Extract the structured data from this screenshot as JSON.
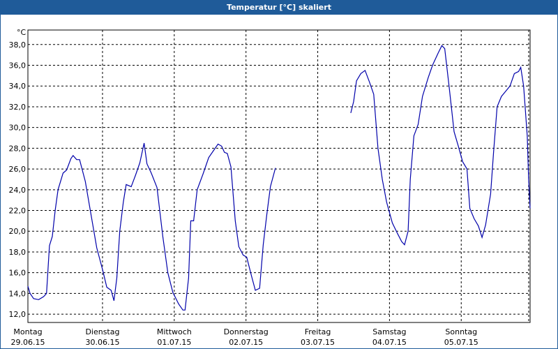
{
  "window": {
    "title": "Temperatur [°C] skaliert"
  },
  "chart_data": {
    "type": "line",
    "title": "Temperatur [°C] skaliert",
    "ylabel": "°C",
    "xlabel": "",
    "ylim": [
      11.2,
      39.4
    ],
    "xlim": [
      0,
      7
    ],
    "grid": true,
    "yticks": [
      "12,0",
      "14,0",
      "16,0",
      "18,0",
      "20,0",
      "22,0",
      "24,0",
      "26,0",
      "28,0",
      "30,0",
      "32,0",
      "34,0",
      "36,0",
      "38,0"
    ],
    "ytick_values": [
      12,
      14,
      16,
      18,
      20,
      22,
      24,
      26,
      28,
      30,
      32,
      34,
      36,
      38
    ],
    "xtick_labels": [
      {
        "day": "Montag",
        "date": "29.06.15"
      },
      {
        "day": "Dienstag",
        "date": "30.06.15"
      },
      {
        "day": "Mittwoch",
        "date": "01.07.15"
      },
      {
        "day": "Donnerstag",
        "date": "02.07.15"
      },
      {
        "day": "Freitag",
        "date": "03.07.15"
      },
      {
        "day": "Samstag",
        "date": "04.07.15"
      },
      {
        "day": "Sonntag",
        "date": "05.07.15"
      }
    ],
    "series": [
      {
        "color": "#0000aa",
        "segments": [
          [
            [
              0.0,
              14.7
            ],
            [
              0.03,
              14.0
            ],
            [
              0.08,
              13.5
            ],
            [
              0.15,
              13.4
            ],
            [
              0.22,
              13.7
            ],
            [
              0.26,
              14.0
            ],
            [
              0.3,
              18.6
            ],
            [
              0.34,
              19.5
            ],
            [
              0.38,
              22.0
            ],
            [
              0.42,
              24.0
            ],
            [
              0.49,
              25.6
            ],
            [
              0.54,
              25.9
            ],
            [
              0.6,
              27.0
            ],
            [
              0.63,
              27.3
            ],
            [
              0.68,
              26.9
            ],
            [
              0.72,
              26.9
            ],
            [
              0.8,
              24.8
            ],
            [
              0.88,
              21.6
            ],
            [
              0.96,
              18.4
            ],
            [
              1.04,
              16.3
            ],
            [
              1.1,
              14.6
            ],
            [
              1.16,
              14.3
            ],
            [
              1.2,
              13.3
            ],
            [
              1.24,
              15.5
            ],
            [
              1.28,
              20.0
            ],
            [
              1.33,
              22.8
            ],
            [
              1.37,
              24.5
            ],
            [
              1.44,
              24.3
            ],
            [
              1.5,
              25.4
            ],
            [
              1.56,
              26.6
            ],
            [
              1.62,
              28.5
            ],
            [
              1.66,
              26.5
            ],
            [
              1.72,
              25.6
            ],
            [
              1.8,
              24.2
            ],
            [
              1.88,
              19.5
            ],
            [
              1.95,
              16.0
            ],
            [
              2.02,
              14.1
            ],
            [
              2.1,
              13.0
            ],
            [
              2.16,
              12.4
            ],
            [
              2.19,
              12.4
            ],
            [
              2.24,
              15.5
            ],
            [
              2.27,
              21.0
            ],
            [
              2.31,
              21.0
            ],
            [
              2.36,
              24.0
            ],
            [
              2.44,
              25.5
            ],
            [
              2.52,
              27.1
            ],
            [
              2.6,
              27.9
            ],
            [
              2.65,
              28.4
            ],
            [
              2.7,
              28.2
            ],
            [
              2.74,
              27.6
            ],
            [
              2.78,
              27.5
            ],
            [
              2.83,
              26.2
            ],
            [
              2.89,
              21.0
            ],
            [
              2.94,
              18.5
            ],
            [
              3.0,
              17.7
            ],
            [
              3.05,
              17.5
            ],
            [
              3.12,
              15.6
            ],
            [
              3.17,
              14.3
            ],
            [
              3.23,
              14.5
            ],
            [
              3.28,
              18.7
            ],
            [
              3.33,
              21.6
            ],
            [
              3.38,
              24.3
            ],
            [
              3.45,
              26.1
            ]
          ],
          [
            [
              4.5,
              31.4
            ],
            [
              4.54,
              32.5
            ],
            [
              4.58,
              34.5
            ],
            [
              4.64,
              35.2
            ],
            [
              4.7,
              35.5
            ],
            [
              4.76,
              34.4
            ],
            [
              4.82,
              33.2
            ],
            [
              4.88,
              28.0
            ],
            [
              4.94,
              25.0
            ],
            [
              5.0,
              22.8
            ],
            [
              5.08,
              20.8
            ],
            [
              5.15,
              19.8
            ],
            [
              5.21,
              19.0
            ],
            [
              5.25,
              18.7
            ],
            [
              5.3,
              20.0
            ],
            [
              5.33,
              25.0
            ],
            [
              5.38,
              29.2
            ],
            [
              5.44,
              30.3
            ],
            [
              5.5,
              33.0
            ],
            [
              5.58,
              34.8
            ],
            [
              5.64,
              36.0
            ],
            [
              5.72,
              37.2
            ],
            [
              5.77,
              37.9
            ],
            [
              5.81,
              37.6
            ],
            [
              5.87,
              34.0
            ],
            [
              5.94,
              29.6
            ],
            [
              6.0,
              28.2
            ],
            [
              6.06,
              26.7
            ],
            [
              6.12,
              26.0
            ],
            [
              6.16,
              22.2
            ],
            [
              6.22,
              21.2
            ],
            [
              6.28,
              20.5
            ],
            [
              6.33,
              19.4
            ],
            [
              6.38,
              20.6
            ],
            [
              6.45,
              23.6
            ],
            [
              6.49,
              27.5
            ],
            [
              6.54,
              32.0
            ],
            [
              6.6,
              33.0
            ],
            [
              6.66,
              33.5
            ],
            [
              6.72,
              34.0
            ],
            [
              6.78,
              35.2
            ],
            [
              6.84,
              35.4
            ],
            [
              6.87,
              35.8
            ],
            [
              6.91,
              34.0
            ],
            [
              6.96,
              29.2
            ],
            [
              6.98,
              25.0
            ],
            [
              7.0,
              22.2
            ]
          ]
        ]
      }
    ]
  }
}
